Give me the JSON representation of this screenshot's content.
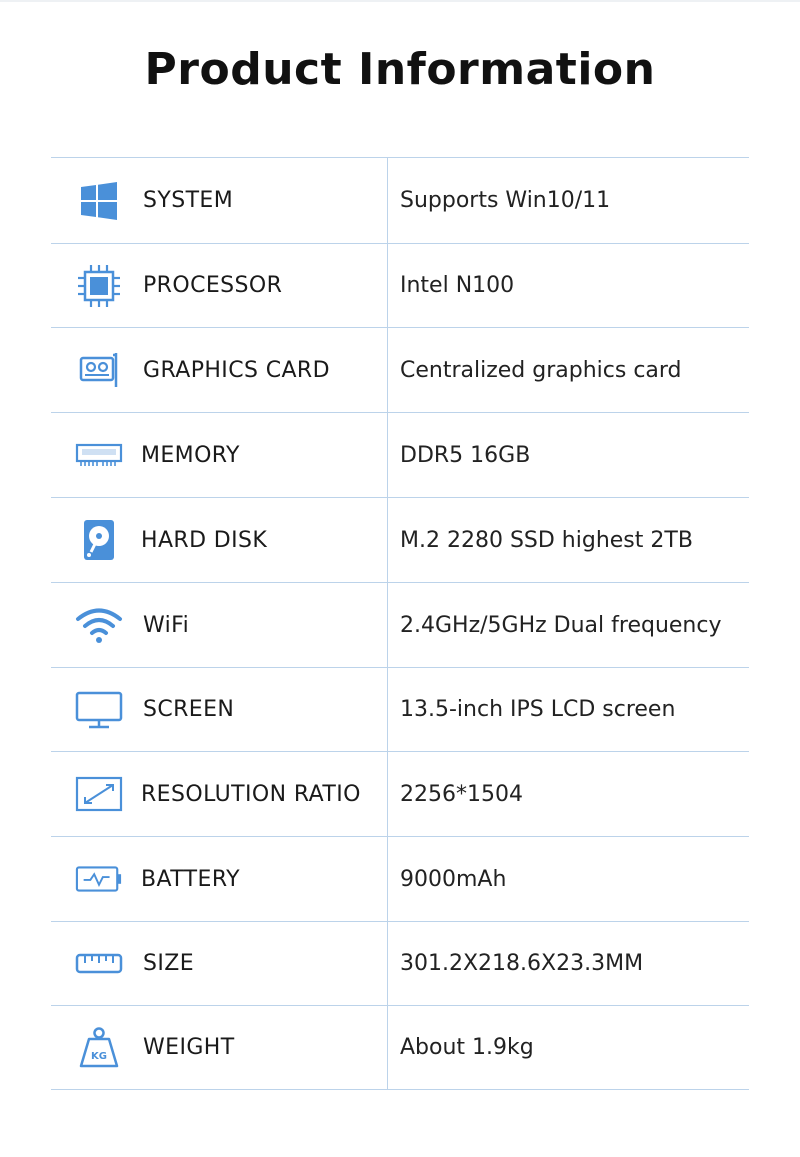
{
  "title": "Product Information",
  "colors": {
    "accent": "#4a90d9",
    "border": "#bcd3ea"
  },
  "specs": [
    {
      "icon": "windows-icon",
      "label": "SYSTEM",
      "value": "Supports Win10/11"
    },
    {
      "icon": "processor-icon",
      "label": "PROCESSOR",
      "value": "Intel N100"
    },
    {
      "icon": "graphics-card-icon",
      "label": "GRAPHICS CARD",
      "value": "Centralized graphics card"
    },
    {
      "icon": "memory-icon",
      "label": "MEMORY",
      "value": "DDR5 16GB"
    },
    {
      "icon": "hard-disk-icon",
      "label": "HARD DISK",
      "value": "M.2 2280 SSD highest 2TB"
    },
    {
      "icon": "wifi-icon",
      "label": "WiFi",
      "value": "2.4GHz/5GHz Dual frequency"
    },
    {
      "icon": "screen-icon",
      "label": "SCREEN",
      "value": "13.5-inch IPS LCD screen"
    },
    {
      "icon": "resolution-icon",
      "label": "RESOLUTION RATIO",
      "value": "2256*1504"
    },
    {
      "icon": "battery-icon",
      "label": "BATTERY",
      "value": "9000mAh"
    },
    {
      "icon": "ruler-icon",
      "label": "SIZE",
      "value": "301.2X218.6X23.3MM"
    },
    {
      "icon": "weight-icon",
      "label": "WEIGHT",
      "value": "About 1.9kg"
    }
  ],
  "weight_icon_text": "KG"
}
